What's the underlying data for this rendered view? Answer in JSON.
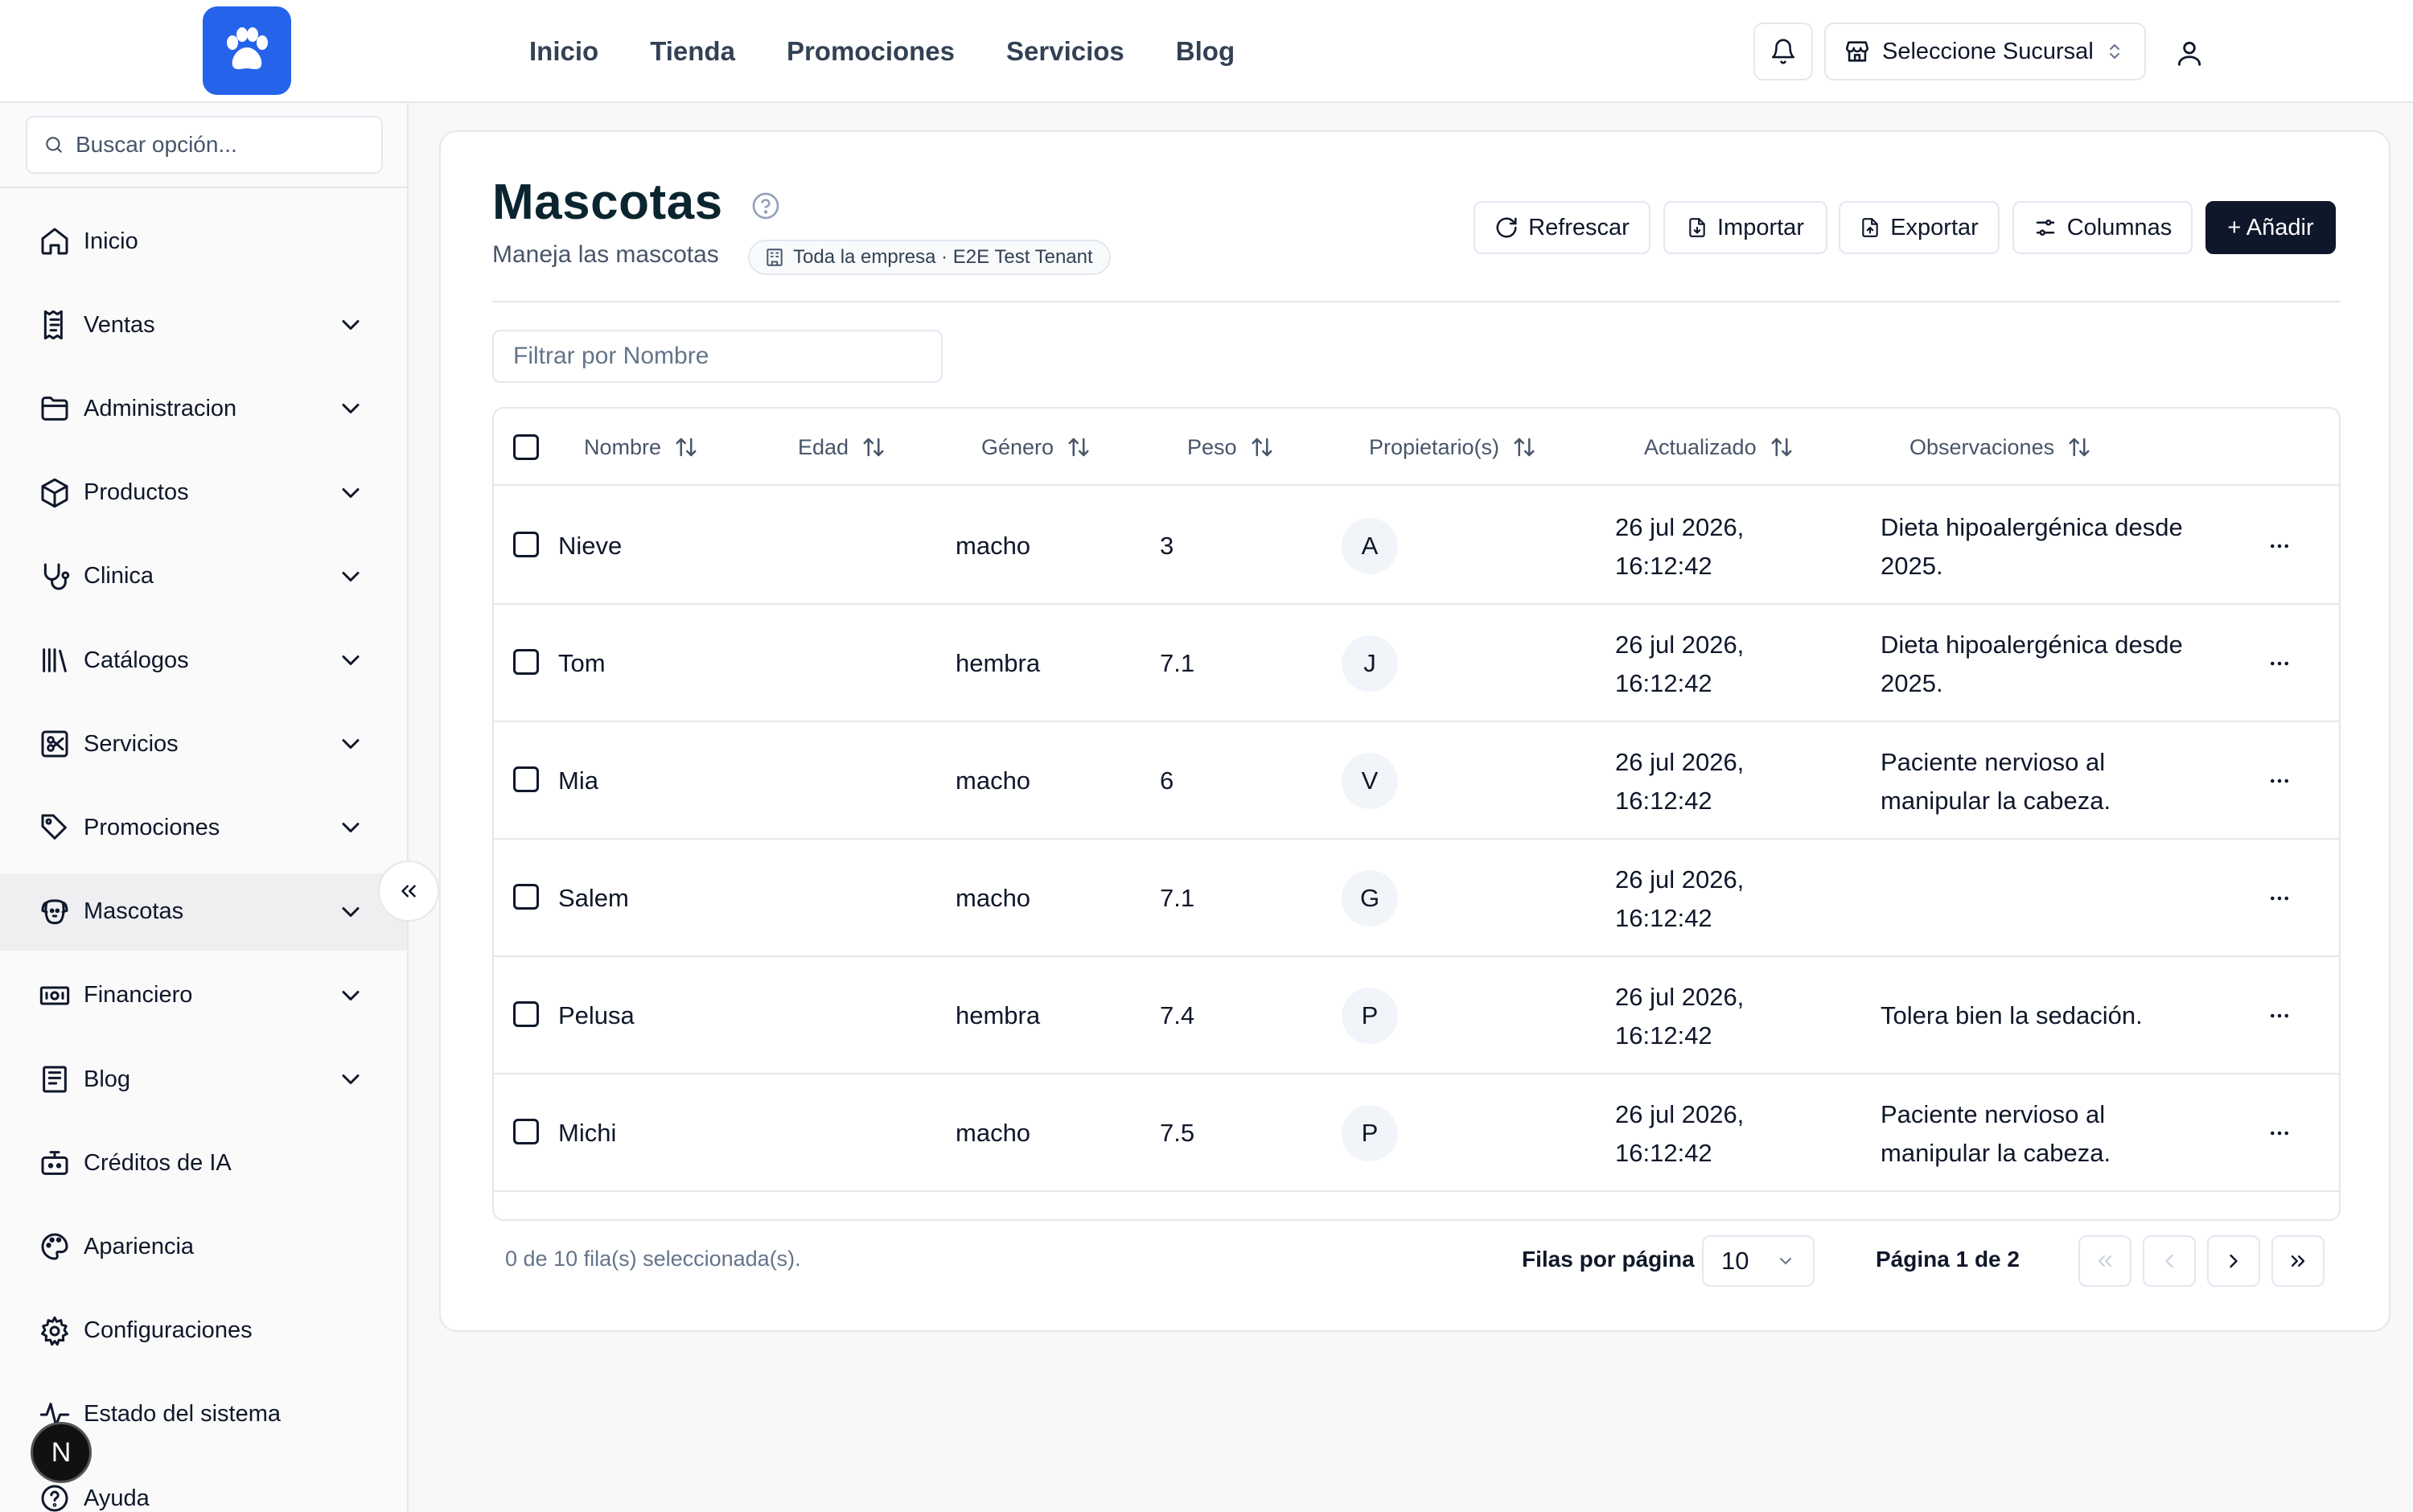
{
  "topnav": {
    "items": [
      "Inicio",
      "Tienda",
      "Promociones",
      "Servicios",
      "Blog"
    ]
  },
  "branch": {
    "label": "Seleccione Sucursal"
  },
  "sidebar": {
    "search_placeholder": "Buscar opción...",
    "items": [
      {
        "label": "Inicio",
        "icon": "home-icon",
        "expandable": false
      },
      {
        "label": "Ventas",
        "icon": "receipt-icon",
        "expandable": true
      },
      {
        "label": "Administracion",
        "icon": "folder-icon",
        "expandable": true
      },
      {
        "label": "Productos",
        "icon": "package-icon",
        "expandable": true
      },
      {
        "label": "Clinica",
        "icon": "stethoscope-icon",
        "expandable": true
      },
      {
        "label": "Catálogos",
        "icon": "library-icon",
        "expandable": true
      },
      {
        "label": "Servicios",
        "icon": "scissors-icon",
        "expandable": true
      },
      {
        "label": "Promociones",
        "icon": "tag-icon",
        "expandable": true
      },
      {
        "label": "Mascotas",
        "icon": "dog-icon",
        "expandable": true,
        "active": true
      },
      {
        "label": "Financiero",
        "icon": "banknote-icon",
        "expandable": true
      },
      {
        "label": "Blog",
        "icon": "newspaper-icon",
        "expandable": true
      },
      {
        "label": "Créditos de IA",
        "icon": "bot-icon",
        "expandable": false
      },
      {
        "label": "Apariencia",
        "icon": "palette-icon",
        "expandable": false
      },
      {
        "label": "Configuraciones",
        "icon": "gear-icon",
        "expandable": false
      },
      {
        "label": "Estado del sistema",
        "icon": "activity-icon",
        "expandable": false
      },
      {
        "label": "Ayuda",
        "icon": "help-circle-icon",
        "expandable": false
      }
    ]
  },
  "n_badge": "N",
  "page": {
    "title": "Mascotas",
    "subtitle": "Maneja las mascotas",
    "tenant_badge": "Toda la empresa · E2E Test Tenant",
    "actions": {
      "refresh": "Refrescar",
      "import": "Importar",
      "export": "Exportar",
      "columns": "Columnas",
      "add": "+ Añadir"
    },
    "filter_placeholder": "Filtrar por Nombre"
  },
  "table": {
    "columns": [
      "Nombre",
      "Edad",
      "Género",
      "Peso",
      "Propietario(s)",
      "Actualizado",
      "Observaciones"
    ],
    "rows": [
      {
        "nombre": "Nieve",
        "edad": "",
        "genero": "macho",
        "peso": "3",
        "propietario": "A",
        "actualizado_1": "26 jul 2026,",
        "actualizado_2": "16:12:42",
        "obs_1": "Dieta hipoalergénica desde",
        "obs_2": "2025."
      },
      {
        "nombre": "Tom",
        "edad": "",
        "genero": "hembra",
        "peso": "7.1",
        "propietario": "J",
        "actualizado_1": "26 jul 2026,",
        "actualizado_2": "16:12:42",
        "obs_1": "Dieta hipoalergénica desde",
        "obs_2": "2025."
      },
      {
        "nombre": "Mia",
        "edad": "",
        "genero": "macho",
        "peso": "6",
        "propietario": "V",
        "actualizado_1": "26 jul 2026,",
        "actualizado_2": "16:12:42",
        "obs_1": "Paciente nervioso al",
        "obs_2": "manipular la cabeza."
      },
      {
        "nombre": "Salem",
        "edad": "",
        "genero": "macho",
        "peso": "7.1",
        "propietario": "G",
        "actualizado_1": "26 jul 2026,",
        "actualizado_2": "16:12:42",
        "obs_1": "",
        "obs_2": ""
      },
      {
        "nombre": "Pelusa",
        "edad": "",
        "genero": "hembra",
        "peso": "7.4",
        "propietario": "P",
        "actualizado_1": "26 jul 2026,",
        "actualizado_2": "16:12:42",
        "obs_1": "Tolera bien la sedación.",
        "obs_2": ""
      },
      {
        "nombre": "Michi",
        "edad": "",
        "genero": "macho",
        "peso": "7.5",
        "propietario": "P",
        "actualizado_1": "26 jul 2026,",
        "actualizado_2": "16:12:42",
        "obs_1": "Paciente nervioso al",
        "obs_2": "manipular la cabeza."
      }
    ]
  },
  "footer": {
    "selected": "0 de 10 fila(s) seleccionada(s).",
    "rows_per_page_label": "Filas por página",
    "rows_per_page": "10",
    "page_label": "Página 1 de 2"
  },
  "colors": {
    "brand": "#2563eb",
    "primary_button": "#0f172a",
    "title": "#0b2530"
  }
}
